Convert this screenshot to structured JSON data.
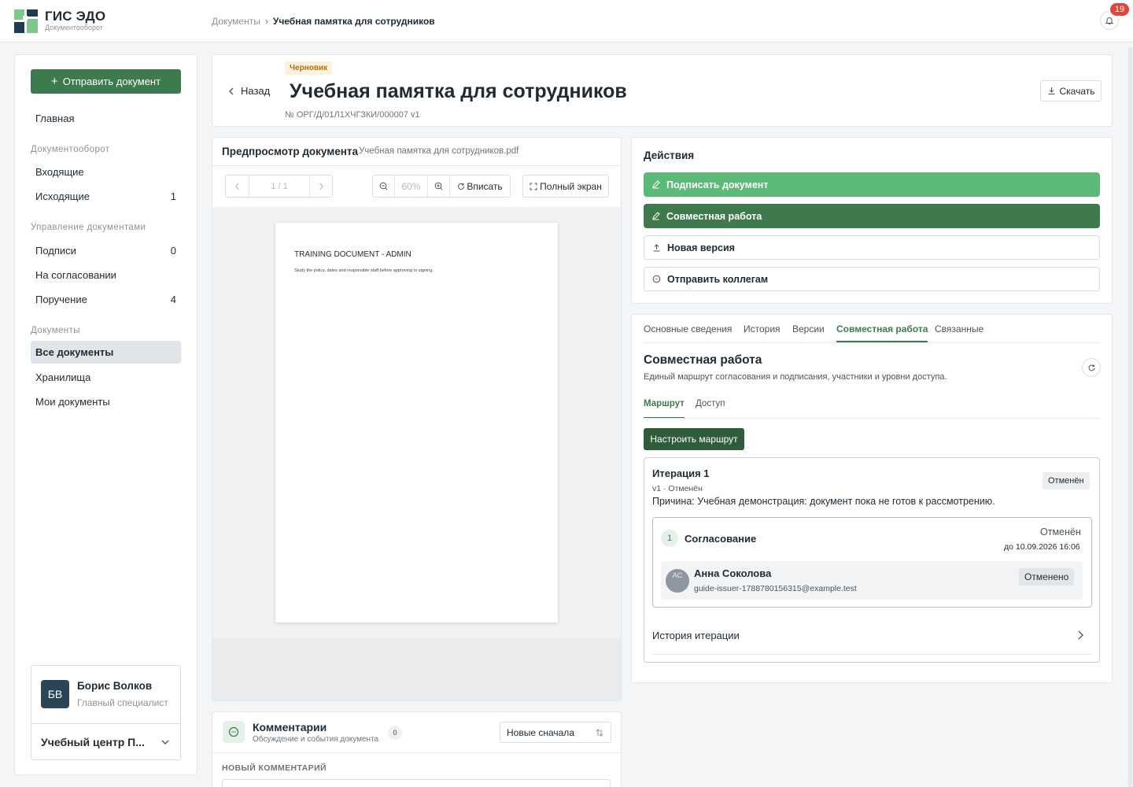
{
  "header": {
    "brand_title": "ГИС ЭДО",
    "brand_sub": "Документооборот",
    "breadcrumb_root": "Документы",
    "breadcrumb_sep": "›",
    "breadcrumb_current": "Учебная памятка для сотрудников",
    "notifications_count": "19"
  },
  "sidebar": {
    "send_button": "Отправить документ",
    "home": "Главная",
    "section_flow": "Документооборот",
    "incoming": "Входящие",
    "outgoing": "Исходящие",
    "outgoing_count": "1",
    "section_manage": "Управление документами",
    "signatures": "Подписи",
    "signatures_count": "0",
    "approval": "На согласовании",
    "assignment": "Поручение",
    "assignment_count": "4",
    "section_docs": "Документы",
    "all_docs": "Все документы",
    "storages": "Хранилища",
    "my_docs": "Мои документы",
    "user": {
      "initials": "БВ",
      "name": "Борис Волков",
      "role": "Главный специалист",
      "org": "Учебный центр П..."
    }
  },
  "doc": {
    "back": "Назад",
    "status": "Черновик",
    "title": "Учебная памятка для сотрудников",
    "number": "№ ОРГ/Д/01Л1ХЧГЗКИ/000007  v1",
    "download": "Скачать"
  },
  "preview": {
    "title": "Предпросмотр документа",
    "file": "Учебная памятка для сотрудников.pdf",
    "page_indicator": "1 / 1",
    "zoom": "60%",
    "fit": "Вписать",
    "fullscreen": "Полный экран",
    "page_heading": "TRAINING DOCUMENT - ADMIN",
    "page_text": "Study the policy, dates and responsible staff before approving or signing."
  },
  "comments": {
    "title": "Комментарии",
    "subtitle": "Обсуждение и события документа",
    "count": "0",
    "sort": "Новые сначала",
    "new_label": "НОВЫЙ КОММЕНТАРИЙ"
  },
  "actions": {
    "title": "Действия",
    "sign": "Подписать документ",
    "collab": "Совместная работа",
    "new_version": "Новая версия",
    "send_colleagues": "Отправить коллегам"
  },
  "tabs": {
    "items": [
      "Основные сведения",
      "История",
      "Версии",
      "Совместная работа",
      "Связанные"
    ],
    "active_index": 3
  },
  "collab": {
    "title": "Совместная работа",
    "subtitle": "Единый маршрут согласования и подписания, участники и уровни доступа.",
    "subtab_route": "Маршрут",
    "subtab_access": "Доступ",
    "configure_route": "Настроить маршрут",
    "iteration": {
      "title": "Итерация 1",
      "meta": "v1 · Отменён",
      "reason": "Причина: Учебная демонстрация: документ пока не готов к рассмотрению.",
      "badge": "Отменён",
      "stage": {
        "number": "1",
        "title": "Согласование",
        "status": "Отменён",
        "due": "до 10.09.2026 16:06",
        "person": {
          "initials": "АС",
          "name": "Анна Соколова",
          "email": "guide-issuer-1788780156315@example.test",
          "status": "Отменено"
        }
      },
      "history": "История итерации"
    }
  },
  "colors": {
    "accent": "#3d7a4e",
    "sign_button": "#5cba78",
    "dark_button": "#2f5d3c",
    "badge_red": "#e0453a"
  }
}
